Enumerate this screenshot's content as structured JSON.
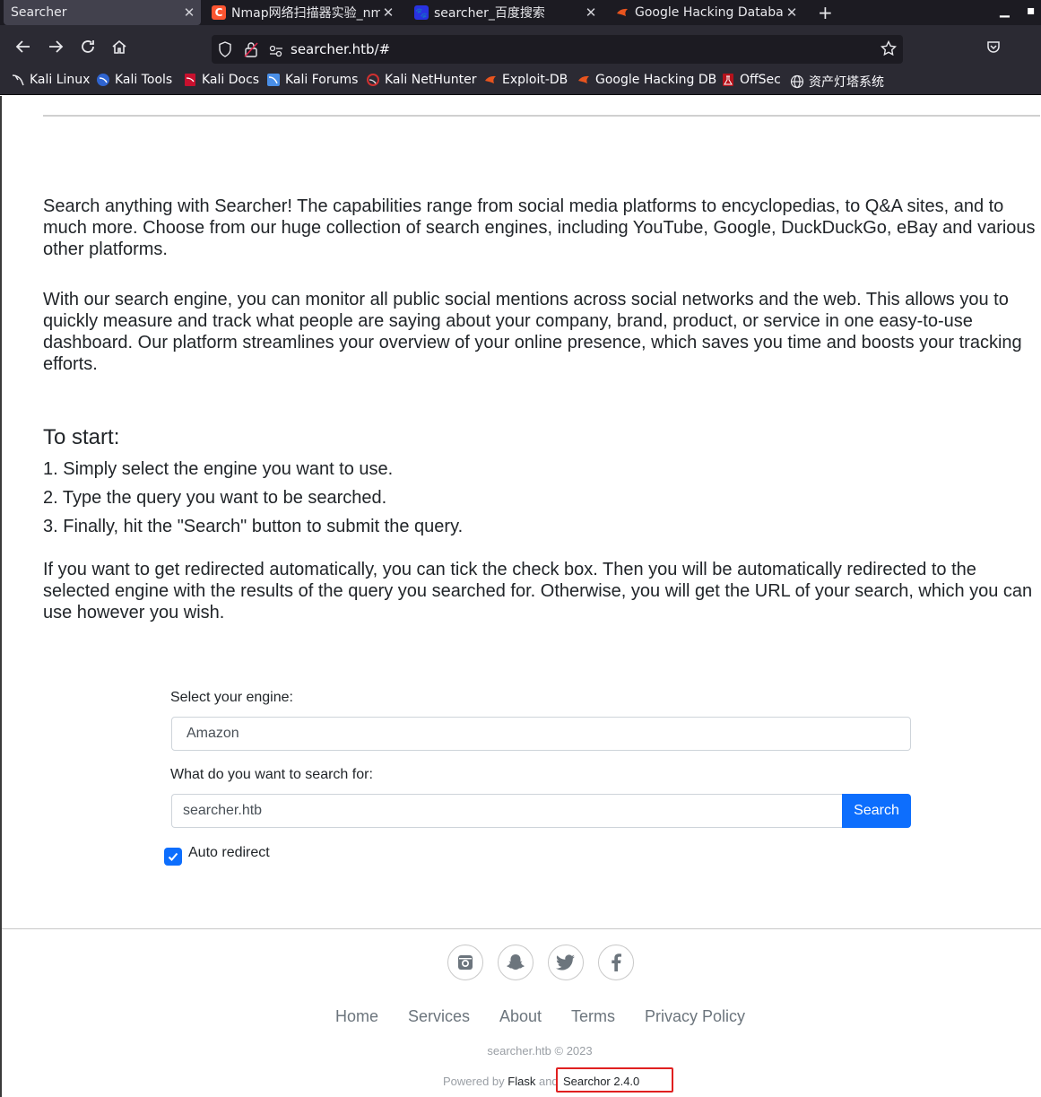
{
  "browser": {
    "tabs": [
      {
        "title": "Searcher",
        "active": true
      },
      {
        "title": "Nmap网络扫描器实验_nmap",
        "active": false
      },
      {
        "title": "searcher_百度搜索",
        "active": false
      },
      {
        "title": "Google Hacking Database",
        "active": false
      }
    ],
    "url": "searcher.htb/#",
    "bookmarks": [
      "Kali Linux",
      "Kali Tools",
      "Kali Docs",
      "Kali Forums",
      "Kali NetHunter",
      "Exploit-DB",
      "Google Hacking DB",
      "OffSec",
      "资产灯塔系统"
    ]
  },
  "content": {
    "intro1": "Search anything with Searcher! The capabilities range from social media platforms to encyclopedias, to Q&A sites, and to much more. Choose from our huge collection of search engines, including YouTube, Google, DuckDuckGo, eBay and various other platforms.",
    "intro2": "With our search engine, you can monitor all public social mentions across social networks and the web. This allows you to quickly measure and track what people are saying about your company, brand, product, or service in one easy-to-use dashboard. Our platform streamlines your overview of your online presence, which saves you time and boosts your tracking efforts.",
    "start_heading": "To start:",
    "steps": [
      "1. Simply select the engine you want to use.",
      "2. Type the query you want to be searched.",
      "3. Finally, hit the \"Search\" button to submit the query."
    ],
    "redirect_text": "If you want to get redirected automatically, you can tick the check box. Then you will be automatically redirected to the selected engine with the results of the query you searched for. Otherwise, you will get the URL of your search, which you can use however you wish."
  },
  "form": {
    "engine_label": "Select your engine:",
    "engine_value": "Amazon",
    "query_label": "What do you want to search for:",
    "query_value": "searcher.htb",
    "search_button": "Search",
    "auto_redirect_label": "Auto redirect",
    "auto_redirect_checked": true
  },
  "footer": {
    "social_icons": [
      "instagram-icon",
      "snapchat-icon",
      "twitter-icon",
      "facebook-icon"
    ],
    "links": [
      "Home",
      "Services",
      "About",
      "Terms",
      "Privacy Policy"
    ],
    "copyright": "searcher.htb © 2023",
    "powered_by": "Powered by",
    "flask": "Flask",
    "and": "and",
    "version": "Searchor 2.4.0"
  },
  "colors": {
    "accent": "#0d6efd",
    "highlight_box": "#e02020",
    "chrome_dark": "#2b2a33"
  }
}
